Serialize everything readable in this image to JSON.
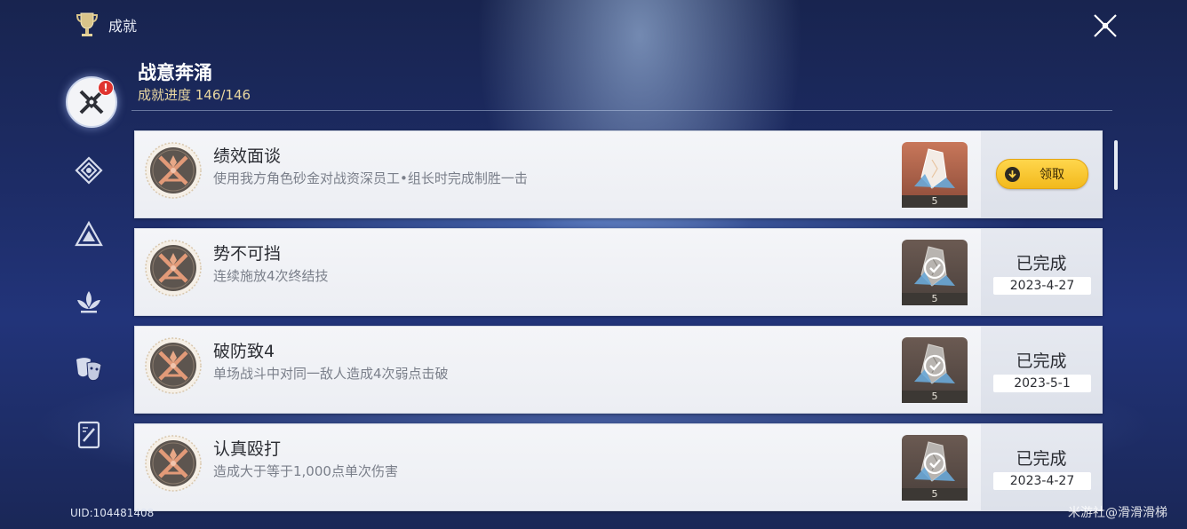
{
  "header": {
    "title": "成就",
    "trophy_icon": "trophy-icon",
    "close_icon": "close-icon"
  },
  "category": {
    "title": "战意奔涌",
    "progress": "成就进度 146/146"
  },
  "sidebar": {
    "items": [
      {
        "icon": "crossed-swords-icon",
        "active": true,
        "badge": "!"
      },
      {
        "icon": "diamond-emblem-icon",
        "active": false
      },
      {
        "icon": "triangle-emblem-icon",
        "active": false
      },
      {
        "icon": "lotus-emblem-icon",
        "active": false
      },
      {
        "icon": "masks-icon",
        "active": false
      },
      {
        "icon": "notebook-icon",
        "active": false
      }
    ]
  },
  "achievements": [
    {
      "name": "绩效面谈",
      "desc": "使用我方角色砂金对战资深员工•组长时完成制胜一击",
      "reward_qty": "5",
      "status": "claimable",
      "claim_label": "领取",
      "date": ""
    },
    {
      "name": "势不可挡",
      "desc": "连续施放4次终结技",
      "reward_qty": "5",
      "status": "done",
      "done_label": "已完成",
      "date": "2023-4-27"
    },
    {
      "name": "破防致4",
      "desc": "单场战斗中对同一敌人造成4次弱点击破",
      "reward_qty": "5",
      "status": "done",
      "done_label": "已完成",
      "date": "2023-5-1"
    },
    {
      "name": "认真殴打",
      "desc": "造成大于等于1,000点单次伤害",
      "reward_qty": "5",
      "status": "done",
      "done_label": "已完成",
      "date": "2023-4-27"
    }
  ],
  "footer": {
    "uid": "UID:104481408",
    "watermark": "米游社@滑滑滑梯"
  },
  "colors": {
    "accent_gold": "#f2b91c",
    "badge_red": "#e0342f",
    "card_bg": "#f4f5f8"
  }
}
